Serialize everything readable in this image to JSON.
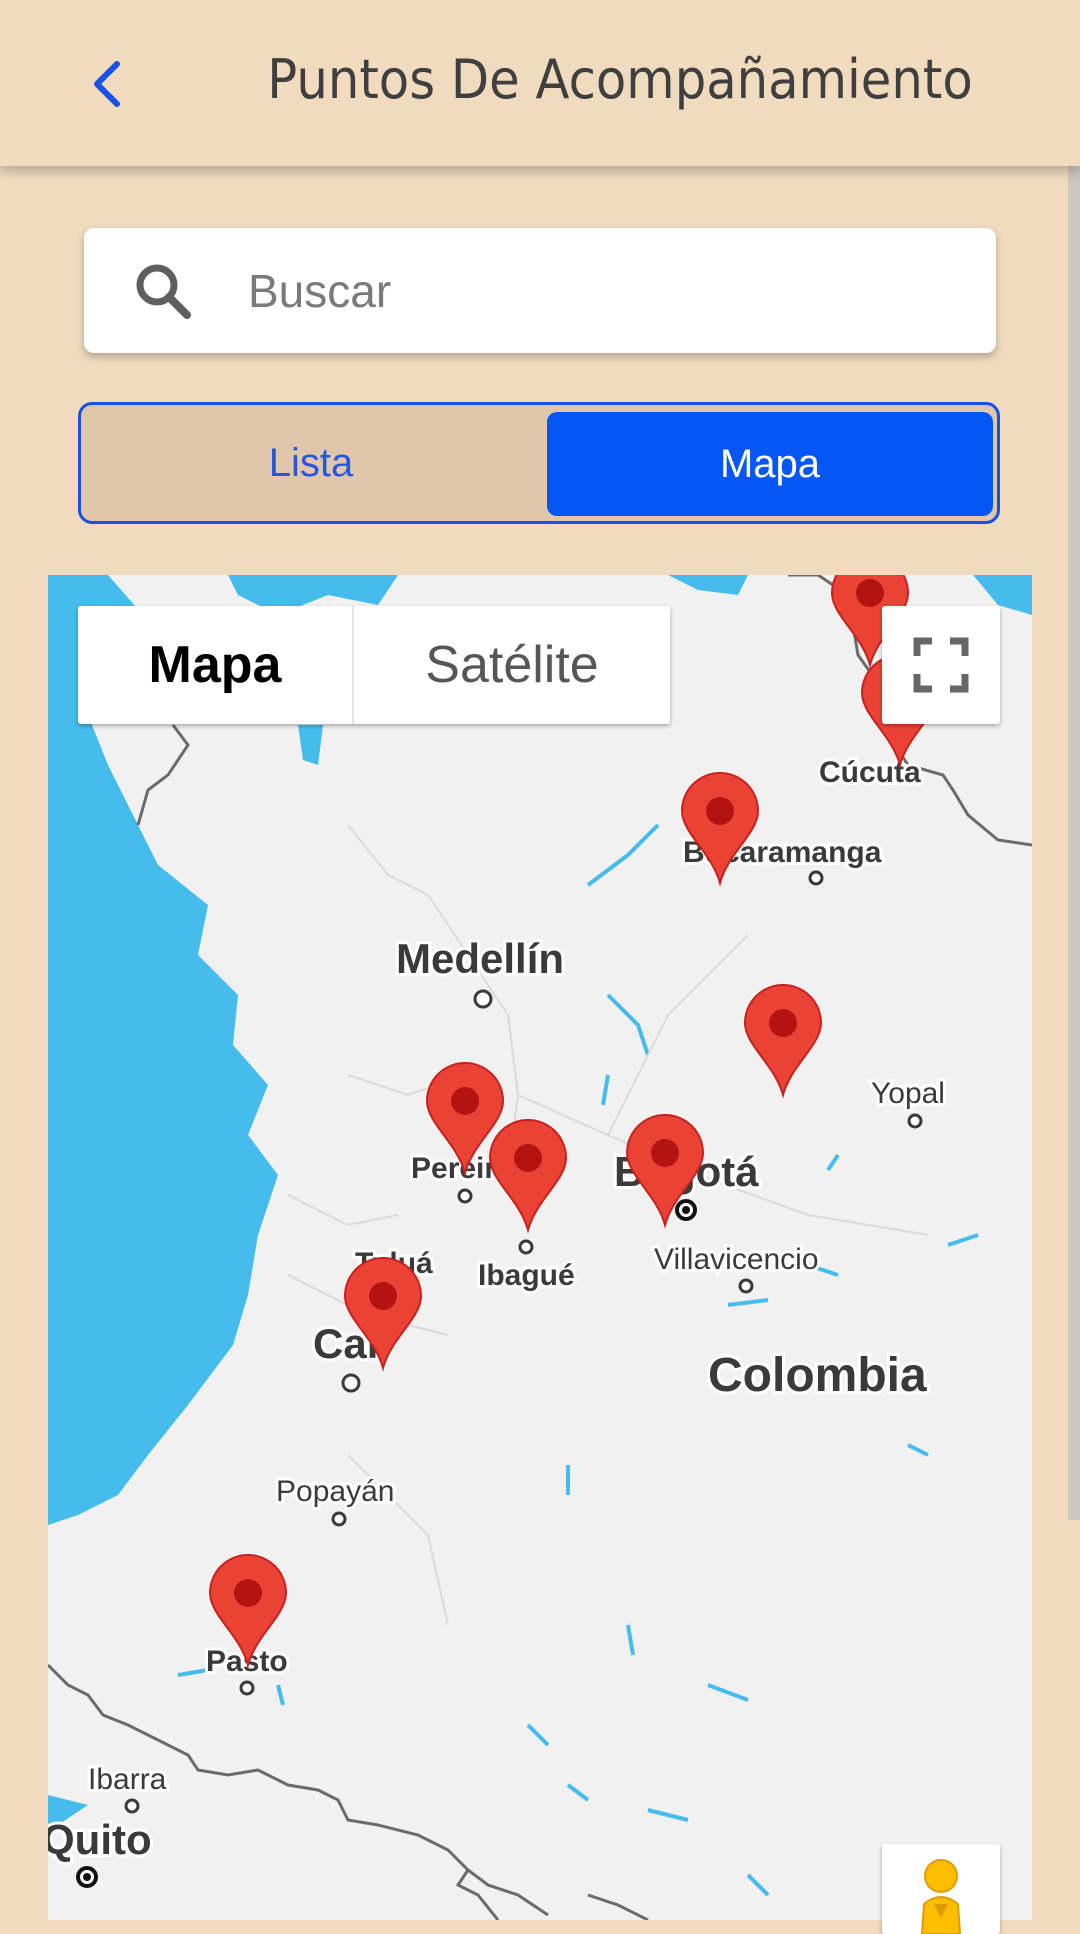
{
  "header": {
    "title": "Puntos De Acompañamiento",
    "back_icon": "chevron-left-icon"
  },
  "search": {
    "placeholder": "Buscar",
    "value": "",
    "icon": "search-icon"
  },
  "view_toggle": {
    "options": [
      "Lista",
      "Mapa"
    ],
    "selected": "Mapa"
  },
  "map": {
    "type_buttons": {
      "map": "Mapa",
      "satellite": "Satélite",
      "selected": "Mapa"
    },
    "fullscreen_icon": "fullscreen-icon",
    "pegman_icon": "street-view-pegman-icon",
    "country_label": "Colombia",
    "cities": [
      "Cúcuta",
      "Bucaramanga",
      "Medellín",
      "Yopal",
      "Pereira",
      "Bogotá",
      "Tuluá",
      "Ibagué",
      "Villavicencio",
      "Cali",
      "Popayán",
      "Pasto",
      "Ibarra",
      "Quito"
    ],
    "markers": [
      "Cúcuta norte",
      "Cúcuta",
      "Bucaramanga",
      "Yopal",
      "Pereira",
      "Ibagué",
      "Bogotá",
      "Cali",
      "Pasto"
    ],
    "colors": {
      "water": "#46bcec",
      "land": "#f1f1f1",
      "marker": "#ea4335",
      "marker_dot": "#b31412"
    }
  },
  "colors": {
    "background": "#f0dbbf",
    "accent": "#0557f5",
    "toggle_bg": "#e0c7ab"
  }
}
